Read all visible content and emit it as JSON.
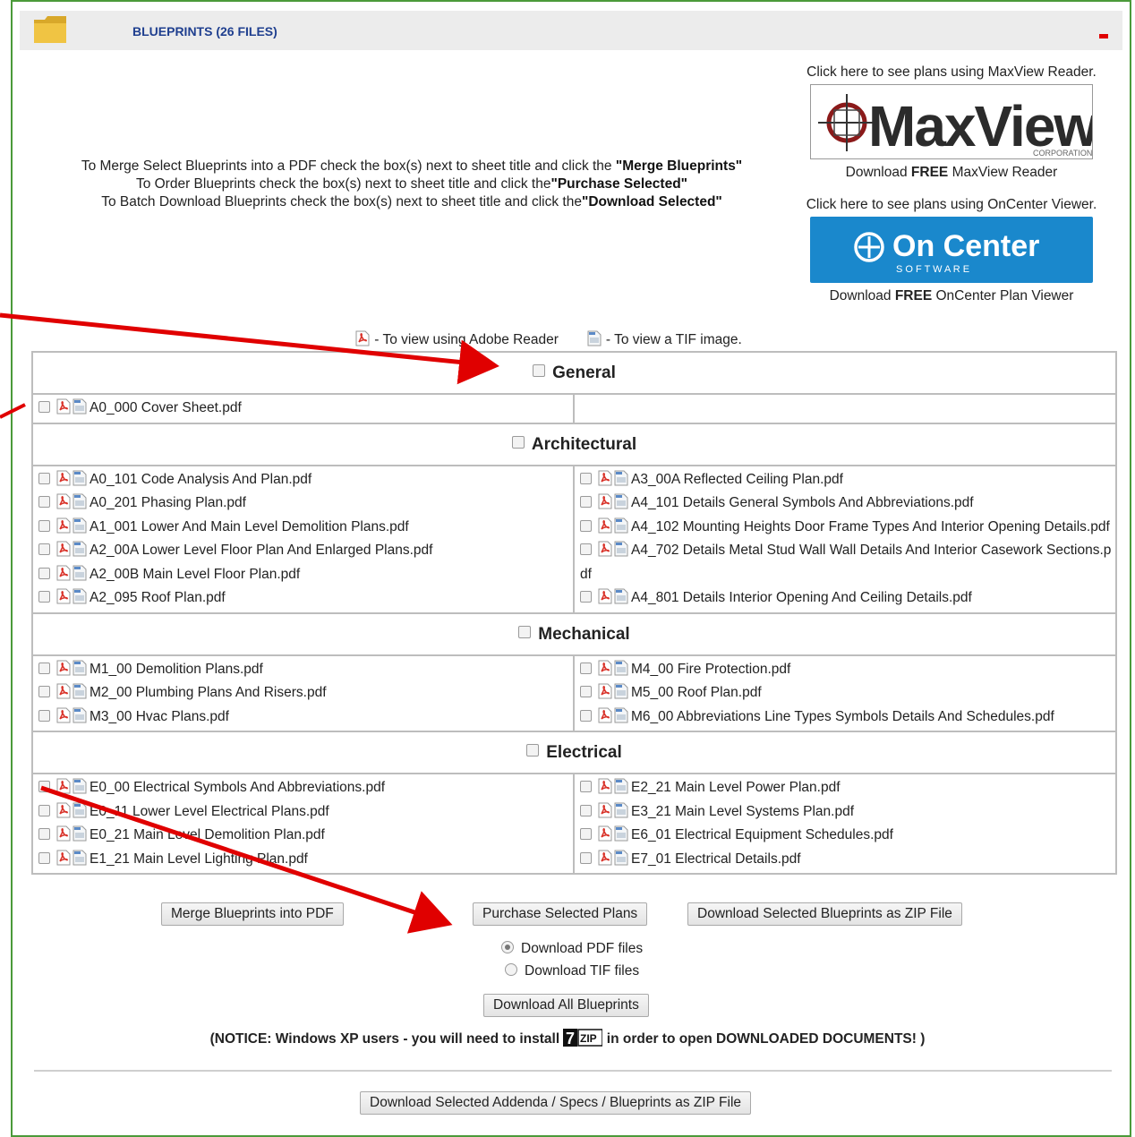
{
  "header": {
    "title": "BLUEPRINTS  (26 FILES)"
  },
  "instructions": [
    {
      "text": "To Merge Select Blueprints into a PDF check the box(s) next to sheet title and click the ",
      "bold": "\"Merge Blueprints\""
    },
    {
      "text": "To Order Blueprints check the box(s) next to sheet title and click the",
      "bold": "\"Purchase Selected\""
    },
    {
      "text": "To Batch Download Blueprints check the box(s) next to sheet title and click the",
      "bold": "\"Download Selected\""
    }
  ],
  "maxview": {
    "caption": "Click here to see plans using MaxView Reader.",
    "logo_text": "MaxView",
    "logo_sub": "CORPORATION",
    "download_prefix": "Download ",
    "download_bold": "FREE",
    "download_suffix": " MaxView Reader"
  },
  "oncenter": {
    "caption": "Click here to see plans using OnCenter Viewer.",
    "logo_text": "On Center",
    "logo_sub": "S O F T W A R E",
    "download_prefix": "Download ",
    "download_bold": "FREE",
    "download_suffix": " OnCenter Plan Viewer"
  },
  "legend": {
    "pdf": " - To view using Adobe Reader",
    "tif": " - To view a TIF image."
  },
  "categories": [
    {
      "name": "General",
      "left": [
        "A0_000 Cover Sheet.pdf"
      ],
      "right": []
    },
    {
      "name": "Architectural",
      "left": [
        "A0_101 Code Analysis And Plan.pdf",
        "A0_201 Phasing Plan.pdf",
        "A1_001 Lower And Main Level Demolition Plans.pdf",
        "A2_00A Lower Level Floor Plan And Enlarged Plans.pdf",
        "A2_00B Main Level Floor Plan.pdf",
        "A2_095 Roof Plan.pdf"
      ],
      "right": [
        "A3_00A Reflected Ceiling Plan.pdf",
        "A4_101 Details General Symbols And Abbreviations.pdf",
        "A4_102 Mounting Heights Door Frame Types And Interior Opening Details.pdf",
        "A4_702 Details Metal Stud Wall Wall Details And Interior Casework Sections.pdf",
        "A4_801 Details Interior Opening And Ceiling Details.pdf"
      ]
    },
    {
      "name": "Mechanical",
      "left": [
        "M1_00 Demolition Plans.pdf",
        "M2_00 Plumbing Plans And Risers.pdf",
        "M3_00 Hvac Plans.pdf"
      ],
      "right": [
        "M4_00 Fire Protection.pdf",
        "M5_00 Roof Plan.pdf",
        "M6_00 Abbreviations Line Types Symbols Details And Schedules.pdf"
      ]
    },
    {
      "name": "Electrical",
      "left": [
        "E0_00 Electrical Symbols And Abbreviations.pdf",
        "E0_11 Lower Level Electrical Plans.pdf",
        "E0_21 Main Level Demolition Plan.pdf",
        "E1_21 Main Level Lighting Plan.pdf"
      ],
      "right": [
        "E2_21 Main Level Power Plan.pdf",
        "E3_21 Main Level Systems Plan.pdf",
        "E6_01 Electrical Equipment Schedules.pdf",
        "E7_01 Electrical Details.pdf"
      ]
    }
  ],
  "buttons": {
    "merge": "Merge Blueprints into PDF",
    "purchase": "Purchase Selected Plans",
    "download_zip": "Download Selected Blueprints as ZIP File",
    "download_all": "Download All Blueprints",
    "download_addenda": "Download Selected Addenda / Specs / Blueprints as ZIP File"
  },
  "format_options": [
    {
      "label": "Download PDF files",
      "selected": true
    },
    {
      "label": "Download TIF files",
      "selected": false
    }
  ],
  "notice": {
    "before": "(NOTICE: Windows XP users - you will need to install ",
    "logo": "7ZIP",
    "after": " in order to open DOWNLOADED DOCUMENTS! )"
  },
  "colors": {
    "frame": "#4b9a3a",
    "header_title": "#1f3f8f",
    "oncenter_blue": "#1a88cc",
    "annotation_arrow": "#e00000",
    "pdf_icon": "#d9342b"
  }
}
